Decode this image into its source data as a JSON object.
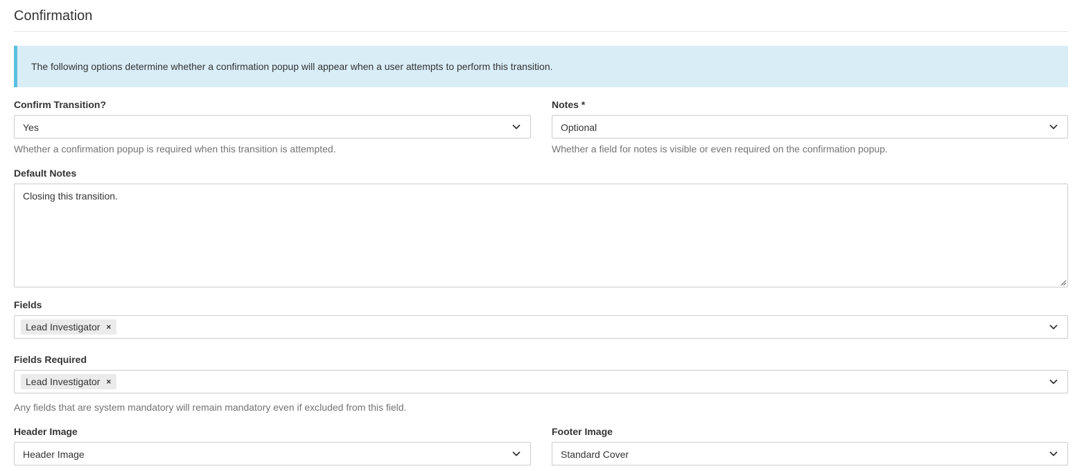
{
  "section": {
    "title": "Confirmation"
  },
  "alert": {
    "text": "The following options determine whether a confirmation popup will appear when a user attempts to perform this transition."
  },
  "confirm_transition": {
    "label": "Confirm Transition?",
    "value": "Yes",
    "help": "Whether a confirmation popup is required when this transition is attempted."
  },
  "notes": {
    "label": "Notes *",
    "value": "Optional",
    "help": "Whether a field for notes is visible or even required on the confirmation popup."
  },
  "default_notes": {
    "label": "Default Notes",
    "value": "Closing this transition."
  },
  "fields": {
    "label": "Fields",
    "tags": [
      "Lead Investigator"
    ],
    "remove_glyph": "×"
  },
  "fields_required": {
    "label": "Fields Required",
    "tags": [
      "Lead Investigator"
    ],
    "remove_glyph": "×",
    "help": "Any fields that are system mandatory will remain mandatory even if excluded from this field."
  },
  "header_image": {
    "label": "Header Image",
    "value": "Header Image"
  },
  "footer_image": {
    "label": "Footer Image",
    "value": "Standard Cover"
  },
  "colors": {
    "alert_background": "#d9edf7",
    "alert_border": "#5bc0de",
    "help_text": "#737373",
    "tag_background": "#ebebeb"
  },
  "icons": {
    "dropdown": "chevron-down-icon",
    "tag_remove": "close-icon",
    "textarea_resize": "resize-grip-icon"
  }
}
